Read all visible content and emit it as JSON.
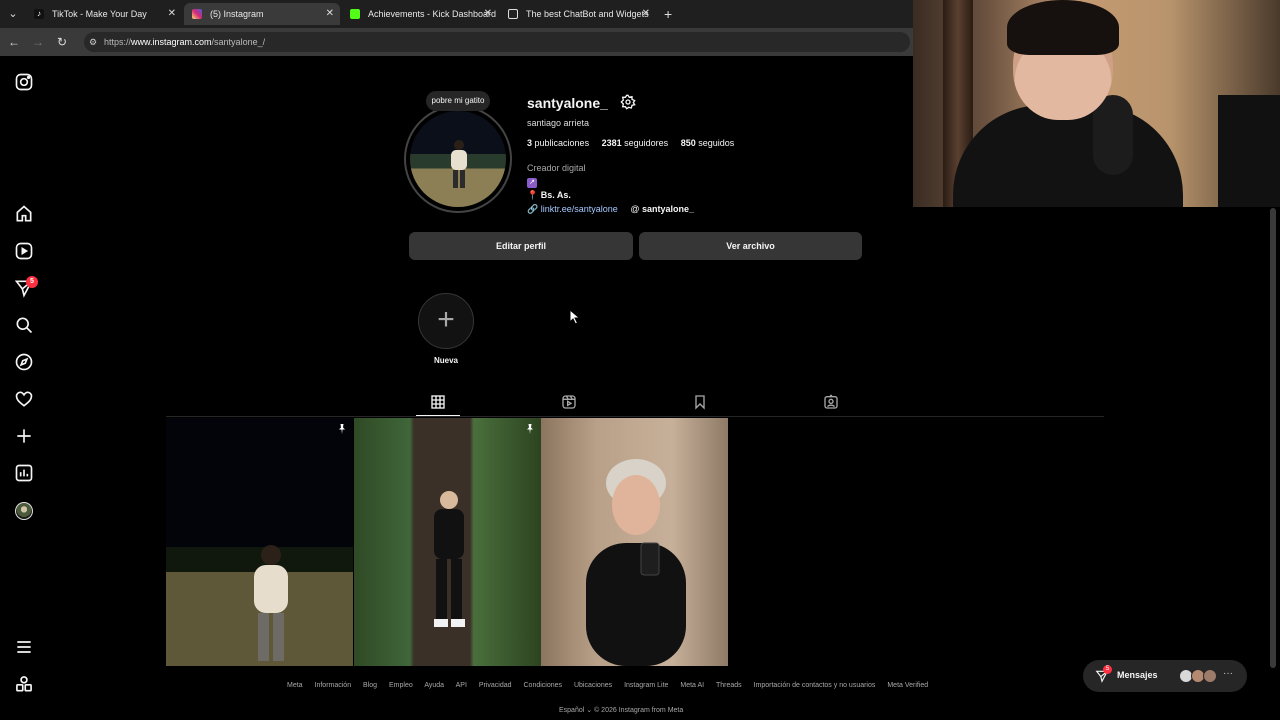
{
  "browser": {
    "tabs": [
      {
        "title": "TikTok - Make Your Day",
        "active": false,
        "favicon_color": "#111111"
      },
      {
        "title": "(5) Instagram",
        "active": true,
        "favicon_color": "#d6249f"
      },
      {
        "title": "Achievements - Kick Dashboard",
        "active": false,
        "favicon_color": "#53fc18"
      },
      {
        "title": "The best ChatBot and Widgets",
        "active": false,
        "favicon_color": "#222222"
      }
    ],
    "url_prefix": "https://",
    "url_host": "www.instagram.com",
    "url_path": "/santyalone_/"
  },
  "sidebar": {
    "notifications_badge": "5",
    "items": [
      "instagram-logo",
      "home",
      "reels",
      "messages",
      "search",
      "explore",
      "notifications",
      "create",
      "dashboard",
      "profile",
      "more",
      "also-from-meta"
    ]
  },
  "profile": {
    "note": "pobre mi gatito",
    "username": "santyalone_",
    "full_name": "santiago arrieta",
    "posts_count": "3",
    "posts_label": "publicaciones",
    "followers_count": "2381",
    "followers_label": "seguidores",
    "following_count": "850",
    "following_label": "seguidos",
    "category": "Creador digital",
    "location": "Bs. As.",
    "link": "linktr.ee/santyalone",
    "threads_handle": "santyalone_",
    "edit_button": "Editar perfil",
    "archive_button": "Ver archivo"
  },
  "highlights": {
    "new_label": "Nueva"
  },
  "footer": {
    "links": [
      "Meta",
      "Información",
      "Blog",
      "Empleo",
      "Ayuda",
      "API",
      "Privacidad",
      "Condiciones",
      "Ubicaciones",
      "Instagram Lite",
      "Meta AI",
      "Threads",
      "Importación de contactos y no usuarios",
      "Meta Verified"
    ],
    "language": "Español",
    "copyright": "© 2026 Instagram from Meta"
  },
  "messages": {
    "label": "Mensajes",
    "badge": "5"
  },
  "colors": {
    "background": "#000000",
    "button": "#363636",
    "badge": "#ff3040",
    "link": "#a5c8ff"
  }
}
